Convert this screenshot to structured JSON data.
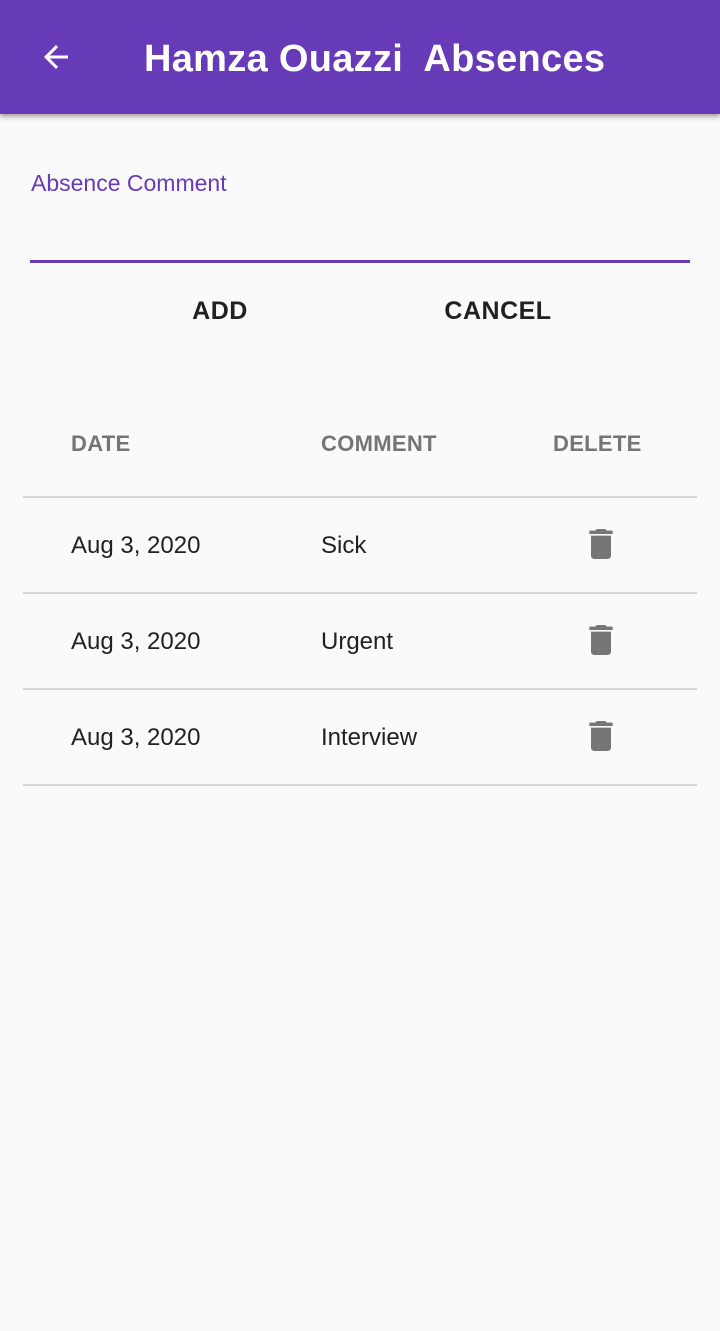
{
  "app_bar": {
    "back_icon": "arrow-left-icon",
    "title": "Hamza Ouazzi  Absences",
    "color": "#673ab7"
  },
  "form": {
    "comment_label": "Absence Comment",
    "comment_value": "",
    "add_label": "ADD",
    "cancel_label": "CANCEL"
  },
  "table": {
    "headers": {
      "date": "DATE",
      "comment": "COMMENT",
      "delete": "DELETE"
    },
    "delete_icon": "trash-icon",
    "rows": [
      {
        "date": "Aug 3, 2020",
        "comment": "Sick"
      },
      {
        "date": "Aug 3, 2020",
        "comment": "Urgent"
      },
      {
        "date": "Aug 3, 2020",
        "comment": "Interview"
      }
    ]
  }
}
